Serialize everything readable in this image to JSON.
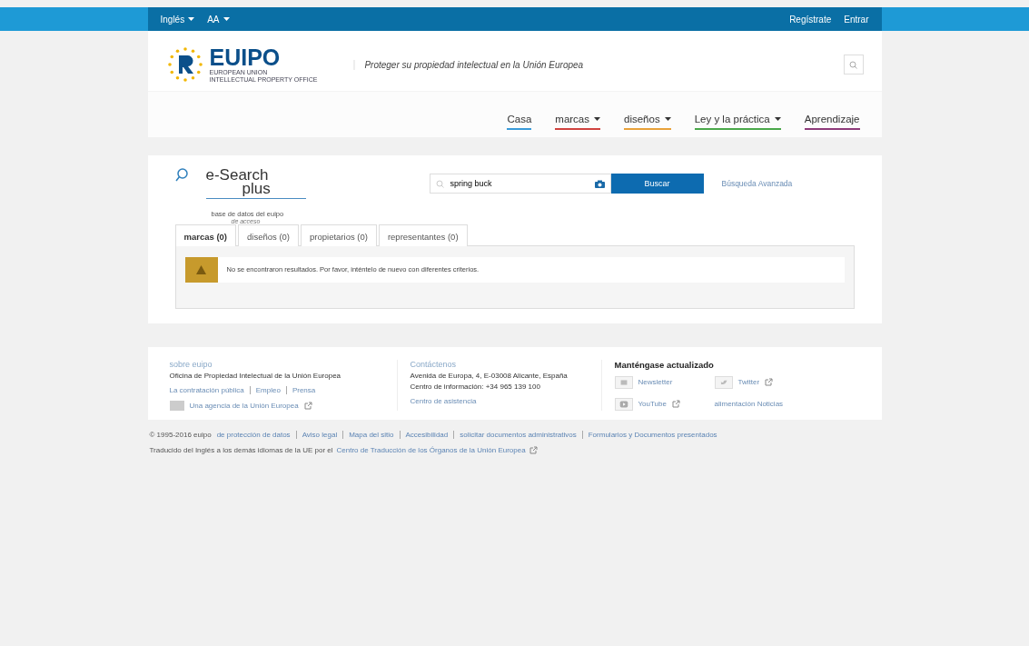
{
  "top_bar": {
    "language": "Inglés",
    "text_size": "AA",
    "links": [
      "Regístrate",
      "Entrar"
    ]
  },
  "header": {
    "logo_name": "EUIPO",
    "logo_sub": [
      "EUROPEAN UNION",
      "INTELLECTUAL PROPERTY OFFICE"
    ],
    "tagline": "Proteger su propiedad intelectual en la Unión Europea",
    "nav": [
      {
        "label": "Casa",
        "has_menu": false,
        "color": "#3a9bd9"
      },
      {
        "label": "marcas",
        "has_menu": true,
        "color": "#d0433f"
      },
      {
        "label": "diseños",
        "has_menu": true,
        "color": "#e8a13a"
      },
      {
        "label": "Ley y la práctica",
        "has_menu": true,
        "color": "#4aa84a"
      },
      {
        "label": "Aprendizaje",
        "has_menu": false,
        "color": "#8e3b7a"
      }
    ]
  },
  "search": {
    "app_title": "e-Search",
    "app_title_2": "plus",
    "subtitle": "base de datos del euipo",
    "subtitle_2": "de acceso",
    "query": "spring buck",
    "button": "Buscar",
    "advanced": "Búsqueda Avanzada",
    "tabs": [
      {
        "label": "marcas (0)",
        "selected": true
      },
      {
        "label": "diseños (0)",
        "selected": false
      },
      {
        "label": "propietarios (0)",
        "selected": false
      },
      {
        "label": "representantes (0)",
        "selected": false
      }
    ],
    "message": "No se encontraron resultados. Por favor, inténtelo de nuevo con diferentes criterios."
  },
  "footer": {
    "about": {
      "heading": "sobre euipo",
      "text": "Oficina de Propiedad Intelectual de la Unión Europea",
      "links": [
        "La contratación pública",
        "Empleo",
        "Prensa"
      ],
      "agency": "Una agencia de la Unión Europea"
    },
    "contact": {
      "heading": "Contáctenos",
      "address": "Avenida de Europa, 4, E-03008 Alicante, España",
      "info": "Centro de información: +34 965 139 100",
      "help": "Centro de asistencia"
    },
    "updates": {
      "heading": "Manténgase actualizado",
      "items": [
        {
          "kind": "mail",
          "label": "Newsletter",
          "external": false
        },
        {
          "kind": "twitter",
          "label": "Twitter",
          "external": true
        },
        {
          "kind": "video",
          "label": "YouTube",
          "external": true
        },
        {
          "kind": "feed",
          "label": "alimentación Noticias",
          "external": false
        }
      ]
    }
  },
  "legal": {
    "copyright": "© 1995-2016 euipo",
    "links": [
      "de protección de datos",
      "Aviso legal",
      "Mapa del sitio",
      "Accesibilidad",
      "solicitar documentos administrativos",
      "Formularios y Documentos presentados"
    ]
  },
  "translation": {
    "text": "Traducido del Inglés a los demás idiomas de la UE por el",
    "link": "Centro de Traducción de los Órganos de la Unión Europea"
  }
}
